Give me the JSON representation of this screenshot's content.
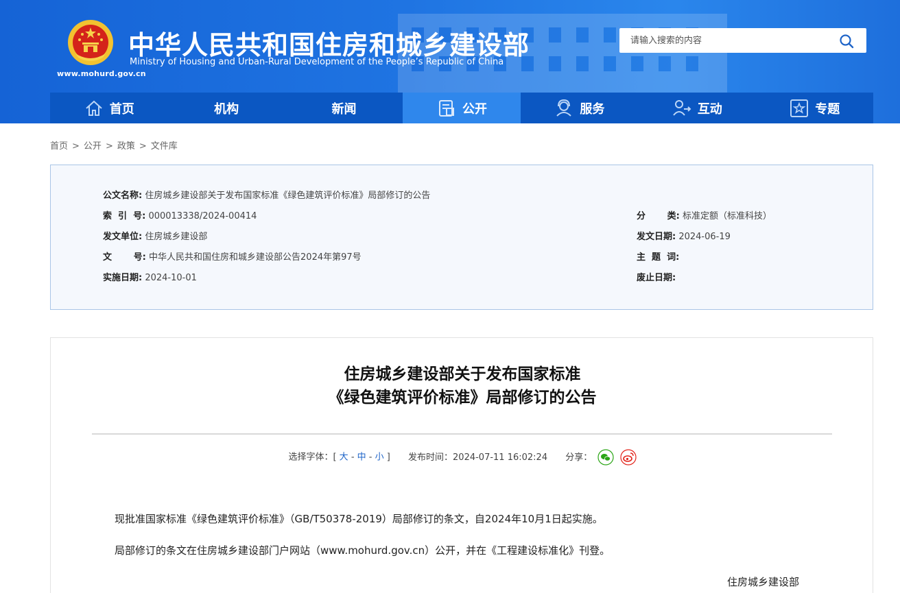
{
  "header": {
    "site_url": "www.mohurd.gov.cn",
    "title_cn": "中华人民共和国住房和城乡建设部",
    "title_en": "Ministry of Housing and Urban-Rural Development of the People’s Republic of China",
    "search_placeholder": "请输入搜索的内容",
    "search_icon": "search-icon",
    "emblem_icon": "national-emblem-icon"
  },
  "nav": {
    "items": [
      {
        "label": "首页",
        "icon": "home-icon"
      },
      {
        "label": "机构",
        "icon": ""
      },
      {
        "label": "新闻",
        "icon": ""
      },
      {
        "label": "公开",
        "icon": "document-icon",
        "active": true
      },
      {
        "label": "服务",
        "icon": "service-icon"
      },
      {
        "label": "互动",
        "icon": "interaction-icon"
      },
      {
        "label": "专题",
        "icon": "star-icon"
      }
    ]
  },
  "breadcrumb": {
    "items": [
      "首页",
      "公开",
      "政策",
      "文件库"
    ],
    "separator": ">"
  },
  "info": {
    "title_label": "公文名称:",
    "title_value": "住房城乡建设部关于发布国家标准《绿色建筑评价标准》局部修订的公告",
    "index_label": "索  引  号:",
    "index_value": "000013338/2024-00414",
    "category_label": "分       类:",
    "category_value": "标准定额（标准科技）",
    "issuer_label": "发文单位:",
    "issuer_value": "住房城乡建设部",
    "date_label": "发文日期:",
    "date_value": "2024-06-19",
    "docno_label": "文       号:",
    "docno_value": "中华人民共和国住房和城乡建设部公告2024年第97号",
    "keywords_label": "主  题  词:",
    "keywords_value": "",
    "effective_label": "实施日期:",
    "effective_value": "2024-10-01",
    "expiry_label": "废止日期:",
    "expiry_value": ""
  },
  "article": {
    "title_line1": "住房城乡建设部关于发布国家标准",
    "title_line2": "《绿色建筑评价标准》局部修订的公告",
    "font_label": "选择字体：[",
    "font_large": "大",
    "font_medium": "中",
    "font_small": "小",
    "font_close": "]",
    "publish_label": "发布时间：",
    "publish_time": "2024-07-11 16:02:24",
    "share_label": "分享：",
    "share_wechat": "wechat-icon",
    "share_weibo": "weibo-icon",
    "colors": {
      "wechat": "#2aa515",
      "weibo": "#e2231a"
    },
    "para1": "现批准国家标准《绿色建筑评价标准》（GB/T50378-2019）局部修订的条文，自2024年10月1日起实施。",
    "para2": "局部修订的条文在住房城乡建设部门户网站（www.mohurd.gov.cn）公开，并在《工程建设标准化》刊登。",
    "signature": "住房城乡建设部"
  }
}
